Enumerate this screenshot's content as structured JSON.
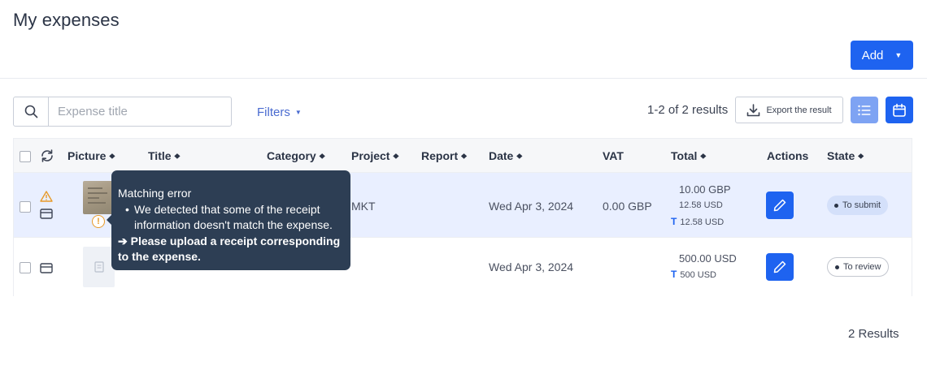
{
  "page": {
    "title": "My expenses"
  },
  "toolbar": {
    "add_label": "Add",
    "search_placeholder": "Expense title",
    "filters_label": "Filters",
    "results_count": "1-2 of 2 results",
    "export_label": "Export the result"
  },
  "table": {
    "columns": {
      "picture": "Picture",
      "title": "Title",
      "category": "Category",
      "project": "Project",
      "report": "Report",
      "date": "Date",
      "vat": "VAT",
      "total": "Total",
      "actions": "Actions",
      "state": "State"
    },
    "rows": [
      {
        "project": "MKT",
        "date": "Wed Apr 3, 2024",
        "vat": "0.00 GBP",
        "total_main": "10.00 GBP",
        "total_sub": "12.58 USD",
        "total_t_mark": "T",
        "total_t": "12.58 USD",
        "state": "To submit",
        "warning_mark": "!"
      },
      {
        "date": "Wed Apr 3, 2024",
        "total_main": "500.00 USD",
        "total_t_mark": "T",
        "total_t": "500 USD",
        "state": "To review"
      }
    ]
  },
  "tooltip": {
    "heading": "Matching error",
    "bullet": "We detected that some of the receipt information doesn't match the expense.",
    "action_arrow": "➔",
    "action": "Please upload a receipt corresponding to the expense."
  },
  "footer": {
    "results": "2 Results"
  },
  "colors": {
    "primary": "#1e63f0",
    "row_highlight": "#e9efff",
    "warning": "#e79a2a",
    "tooltip_bg": "#2d3e54"
  },
  "icons": [
    "search-icon",
    "download-icon",
    "list-view-icon",
    "calendar-icon",
    "refresh-icon",
    "warning-triangle-icon",
    "card-icon",
    "pencil-icon",
    "receipt-icon"
  ]
}
